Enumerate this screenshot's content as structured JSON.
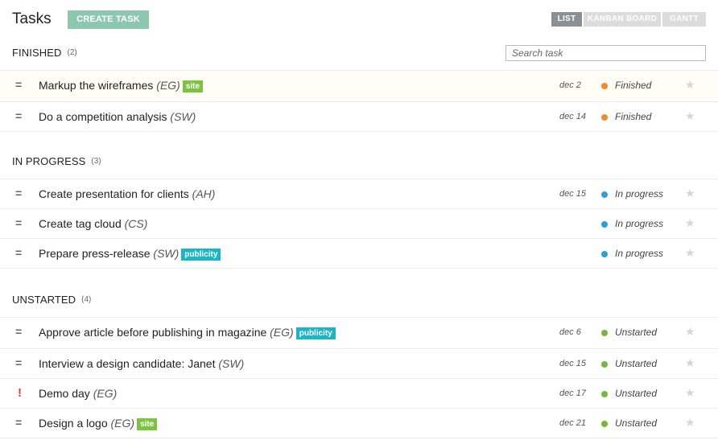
{
  "header": {
    "title": "Tasks",
    "create_label": "CREATE TASK",
    "views": [
      "LIST",
      "KANBAN BOARD",
      "GANTT"
    ],
    "active_view": "LIST"
  },
  "search": {
    "placeholder": "Search task",
    "value": ""
  },
  "colors": {
    "finished": "#f28a26",
    "in_progress": "#2a9fdc",
    "unstarted": "#74b93c",
    "tag_site": "#7dc342",
    "tag_publicity": "#1cb5c5",
    "accent_button": "#8ec7b0"
  },
  "sections": [
    {
      "title": "FINISHED",
      "count": "(2)",
      "tasks": [
        {
          "icon": "drag-handle-icon",
          "glyph": "=",
          "title": "Markup the wireframes",
          "assignee": "(EG)",
          "tag": "site",
          "due": "dec 2",
          "status": "Finished"
        },
        {
          "icon": "drag-handle-icon",
          "glyph": "=",
          "title": "Do a competition analysis",
          "assignee": "(SW)",
          "tag": "",
          "due": "dec 14",
          "status": "Finished"
        }
      ]
    },
    {
      "title": "IN PROGRESS",
      "count": "(3)",
      "tasks": [
        {
          "icon": "drag-handle-icon",
          "glyph": "=",
          "title": "Create presentation for clients",
          "assignee": "(AH)",
          "tag": "",
          "due": "dec 15",
          "status": "In progress"
        },
        {
          "icon": "drag-handle-icon",
          "glyph": "=",
          "title": "Create tag cloud",
          "assignee": "(CS)",
          "tag": "",
          "due": "",
          "status": "In progress"
        },
        {
          "icon": "drag-handle-icon",
          "glyph": "=",
          "title": "Prepare press-release",
          "assignee": "(SW)",
          "tag": "publicity",
          "due": "",
          "status": "In progress"
        }
      ]
    },
    {
      "title": "UNSTARTED",
      "count": "(4)",
      "tasks": [
        {
          "icon": "drag-handle-icon",
          "glyph": "=",
          "title": "Approve article before publishing in magazine",
          "assignee": "(EG)",
          "tag": "publicity",
          "due": "dec 6",
          "status": "Unstarted"
        },
        {
          "icon": "drag-handle-icon",
          "glyph": "=",
          "title": "Interview a design candidate: Janet",
          "assignee": "(SW)",
          "tag": "",
          "due": "dec 15",
          "status": "Unstarted"
        },
        {
          "icon": "alert-icon",
          "glyph": "!",
          "title": "Demo day",
          "assignee": "(EG)",
          "tag": "",
          "due": "dec 17",
          "status": "Unstarted"
        },
        {
          "icon": "drag-handle-icon",
          "glyph": "=",
          "title": "Design a logo",
          "assignee": "(EG)",
          "tag": "site",
          "due": "dec 21",
          "status": "Unstarted"
        }
      ]
    }
  ]
}
